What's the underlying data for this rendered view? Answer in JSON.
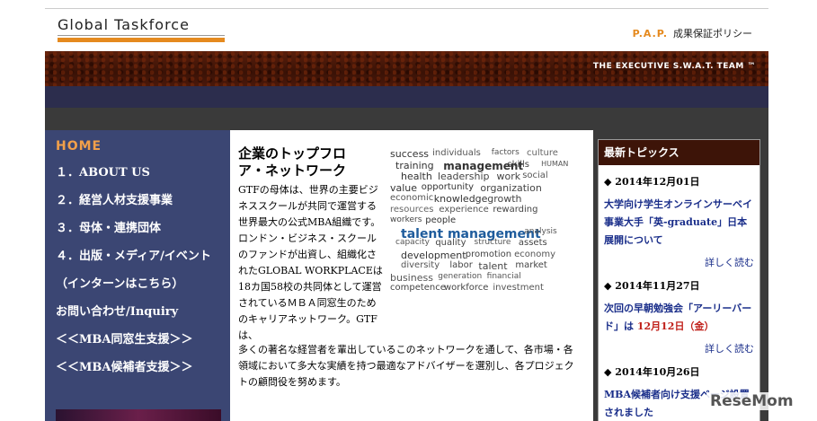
{
  "header": {
    "logo": "Global Taskforce",
    "policy_key": "P.A.P.",
    "policy_label": "成果保証ポリシー",
    "tagline": "THE EXECUTIVE S.W.A.T. TEAM ™"
  },
  "sidebar": {
    "items": [
      {
        "label": "HOME"
      },
      {
        "label": "１．ABOUT US"
      },
      {
        "label": "２．経営人材支援事業"
      },
      {
        "label": "３．母体・連携団体"
      },
      {
        "label": "４．出版・メディア/イベント"
      },
      {
        "label": "（インターンはこちら）"
      },
      {
        "label": "お問い合わせ/Inquiry"
      },
      {
        "label": "＜＜MBA同窓生支援＞＞"
      },
      {
        "label": "＜＜MBA候補者支援＞＞"
      }
    ]
  },
  "article": {
    "title": "企業のトップフロア・ネットワーク",
    "body_narrow": "GTFの母体は、世界の主要ビジネススクールが共同で運営する世界最大の公式MBA組織です。ロンドン・ビジネス・スクールのファンドが出資し、組織化されたGLOBAL WORKPLACEは18カ国58校の共同体として運営されているＭＢＡ同窓生のためのキャリアネットワーク。GTFは、",
    "body_wide": "多くの著名な経営者を輩出しているこのネットワークを通して、各市場・各領域において多大な実績を持つ最適なアドバイザーを選別し、各プロジェクトの顧問役を努めます。"
  },
  "word_cloud": [
    {
      "t": "success",
      "s": 11,
      "c": "#333"
    },
    {
      "t": "individuals",
      "s": 10,
      "c": "#555"
    },
    {
      "t": "factors",
      "s": 9,
      "c": "#555"
    },
    {
      "t": "culture",
      "s": 10,
      "c": "#666"
    },
    {
      "t": "training",
      "s": 11,
      "c": "#333"
    },
    {
      "t": "management",
      "s": 12,
      "c": "#333"
    },
    {
      "t": "skills",
      "s": 10,
      "c": "#444"
    },
    {
      "t": "HUMAN",
      "s": 8,
      "c": "#555"
    },
    {
      "t": "health",
      "s": 11,
      "c": "#333"
    },
    {
      "t": "leadership",
      "s": 11,
      "c": "#444"
    },
    {
      "t": "work",
      "s": 11,
      "c": "#444"
    },
    {
      "t": "social",
      "s": 10,
      "c": "#555"
    },
    {
      "t": "value",
      "s": 11,
      "c": "#333"
    },
    {
      "t": "opportunity",
      "s": 10,
      "c": "#333"
    },
    {
      "t": "organization",
      "s": 11,
      "c": "#444"
    },
    {
      "t": "economic",
      "s": 10,
      "c": "#555"
    },
    {
      "t": "knowledge",
      "s": 11,
      "c": "#333"
    },
    {
      "t": "growth",
      "s": 11,
      "c": "#444"
    },
    {
      "t": "resources",
      "s": 10,
      "c": "#666"
    },
    {
      "t": "experience",
      "s": 10,
      "c": "#555"
    },
    {
      "t": "rewarding",
      "s": 10,
      "c": "#444"
    },
    {
      "t": "workers",
      "s": 9,
      "c": "#444"
    },
    {
      "t": "people",
      "s": 10,
      "c": "#333"
    },
    {
      "t": "talent management",
      "s": 14,
      "c": "#1f5c9c"
    },
    {
      "t": "analysis",
      "s": 9,
      "c": "#555"
    },
    {
      "t": "capacity",
      "s": 9,
      "c": "#555"
    },
    {
      "t": "quality",
      "s": 10,
      "c": "#444"
    },
    {
      "t": "structure",
      "s": 9,
      "c": "#555"
    },
    {
      "t": "assets",
      "s": 10,
      "c": "#444"
    },
    {
      "t": "development",
      "s": 11,
      "c": "#333"
    },
    {
      "t": "promotion",
      "s": 10,
      "c": "#444"
    },
    {
      "t": "economy",
      "s": 10,
      "c": "#555"
    },
    {
      "t": "diversity",
      "s": 10,
      "c": "#555"
    },
    {
      "t": "labor",
      "s": 10,
      "c": "#444"
    },
    {
      "t": "talent",
      "s": 11,
      "c": "#444"
    },
    {
      "t": "market",
      "s": 10,
      "c": "#444"
    },
    {
      "t": "business",
      "s": 11,
      "c": "#555"
    },
    {
      "t": "generation",
      "s": 9,
      "c": "#555"
    },
    {
      "t": "financial",
      "s": 9,
      "c": "#555"
    },
    {
      "t": "competence",
      "s": 10,
      "c": "#444"
    },
    {
      "t": "workforce",
      "s": 10,
      "c": "#444"
    },
    {
      "t": "investment",
      "s": 10,
      "c": "#555"
    }
  ],
  "topics": {
    "header": "最新トピックス",
    "items": [
      {
        "date": "2014年12月01日",
        "title_a": "大学向け学生オンラインサーベイ事業大手「英-graduate」日本展開について",
        "title_b": "",
        "title_c": "",
        "more": "詳しく読む"
      },
      {
        "date": "2014年11月27日",
        "title_a": "次回の早朝勉強会「アーリーバード」は",
        "title_b": "12月12日（金）",
        "title_c": "",
        "more": "詳しく読む"
      },
      {
        "date": "2014年10月26日",
        "title_a": "MBA候補者向け支援ページ設置されました",
        "title_b": "",
        "title_c": "",
        "more": ""
      }
    ]
  },
  "watermark": "ReseMom"
}
